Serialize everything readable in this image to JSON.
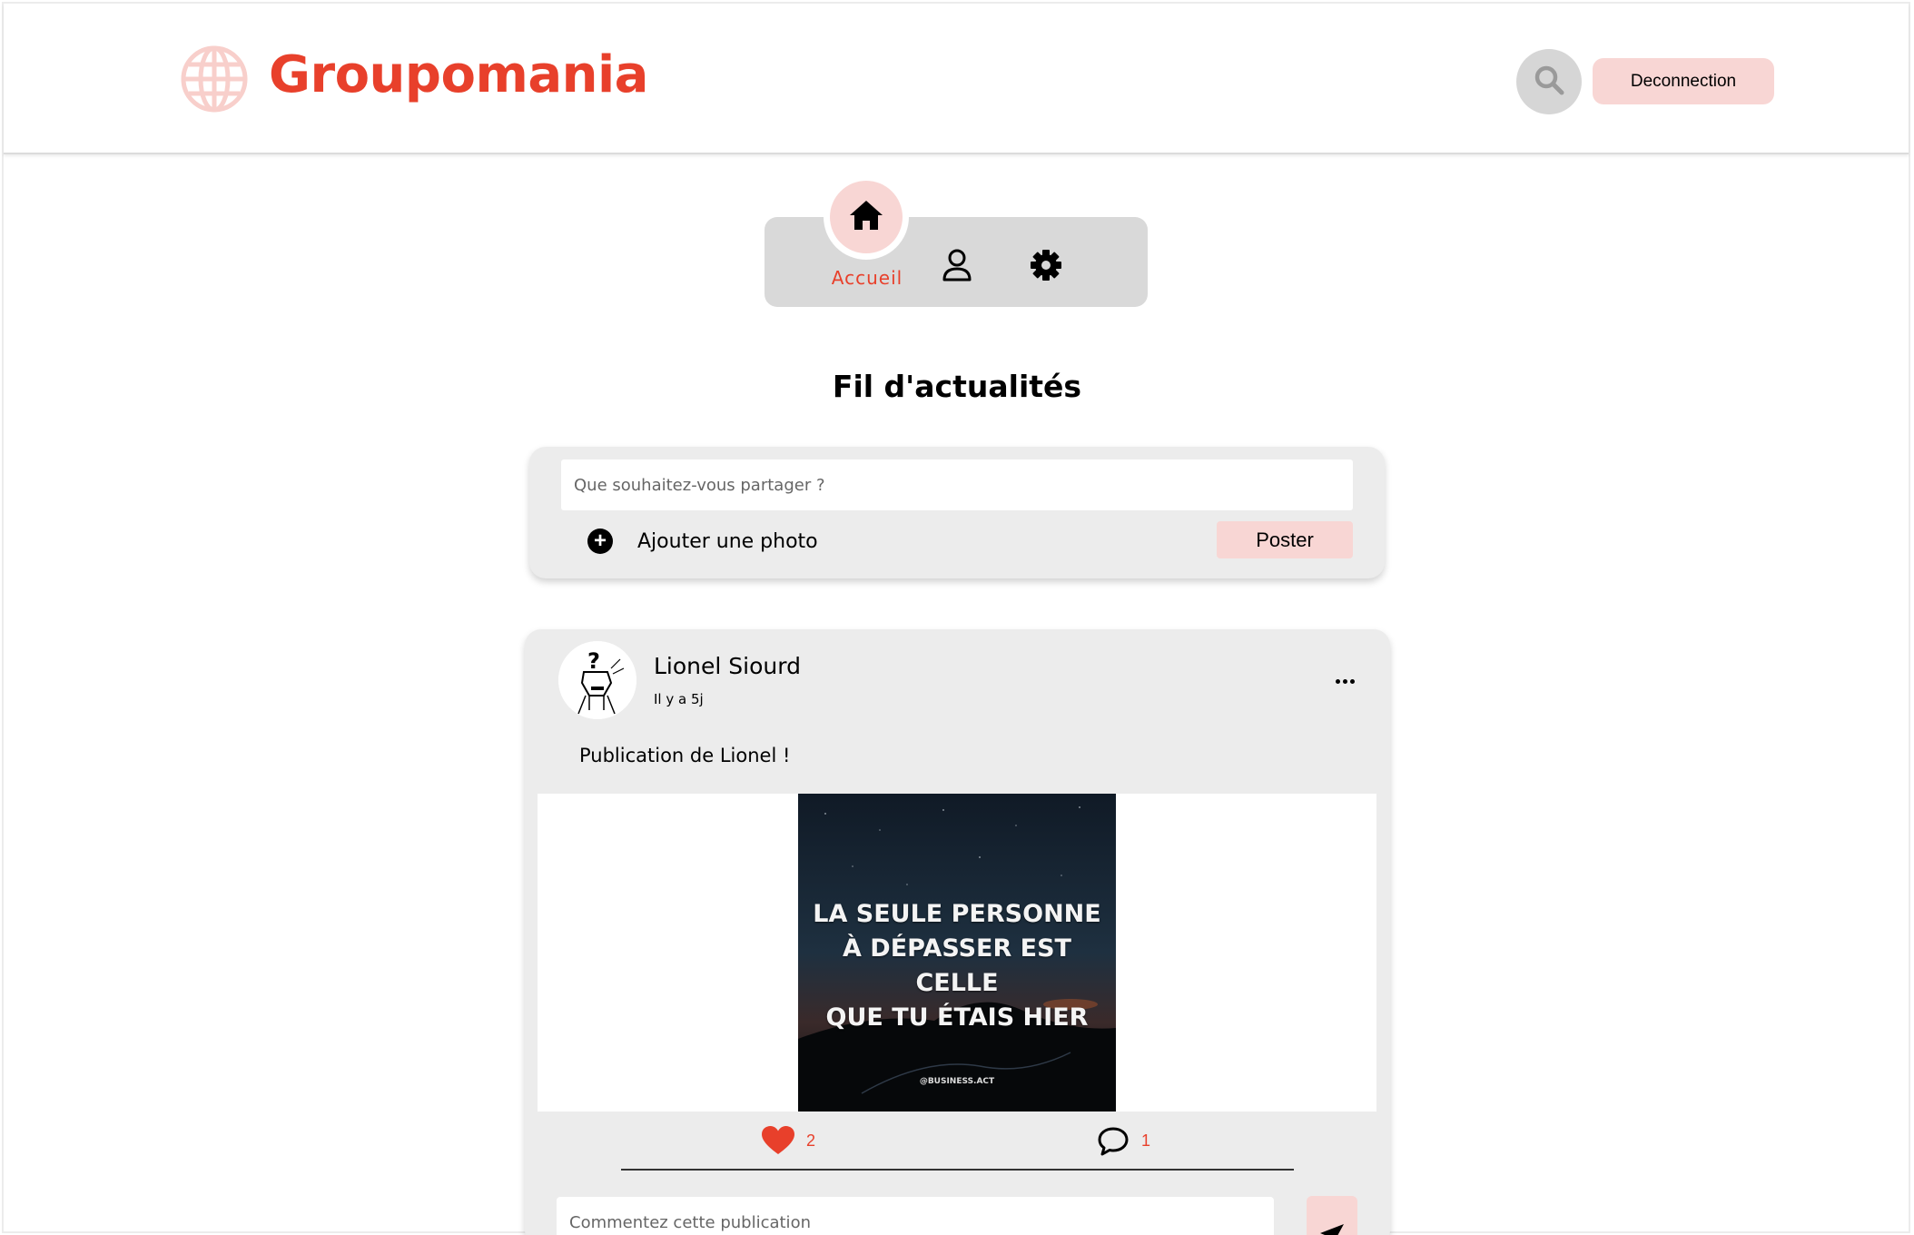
{
  "header": {
    "app_name": "Groupomania",
    "logout_label": "Deconnection",
    "brand_color": "#e8402b",
    "icons": {
      "logo": "globe-icon",
      "search": "search-icon"
    }
  },
  "nav": {
    "items": [
      {
        "label": "Accueil",
        "icon": "home-icon",
        "active": true
      },
      {
        "label": "",
        "icon": "user-icon",
        "active": false
      },
      {
        "label": "",
        "icon": "gear-icon",
        "active": false
      }
    ]
  },
  "main": {
    "title": "Fil d'actualités"
  },
  "composer": {
    "placeholder": "Que souhaitez-vous partager ?",
    "add_photo_label": "Ajouter une photo",
    "post_label": "Poster"
  },
  "post": {
    "author": "Lionel Siourd",
    "time": "Il y a 5j",
    "text": "Publication de Lionel !",
    "image": {
      "quote_lines": [
        "LA SEULE PERSONNE",
        "À DÉPASSER EST CELLE",
        "QUE TU ÉTAIS HIER"
      ],
      "watermark": "@BUSINESS.ACT"
    },
    "likes": "2",
    "comments": "1",
    "comment_placeholder": "Commentez cette publication"
  },
  "colors": {
    "accent": "#e8402b",
    "pink": "#f8d6d4",
    "card_bg": "#ececec",
    "nav_bg": "#d9d9d9"
  }
}
